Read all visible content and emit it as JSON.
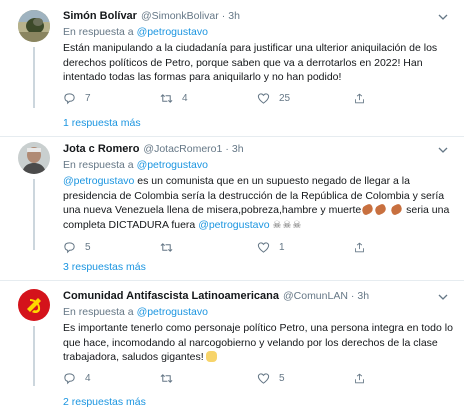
{
  "tweets": [
    {
      "name": "Simón Bolívar",
      "handle": "@SimonkBolivar",
      "dot": "·",
      "time": "3h",
      "reply_prefix": "En respuesta a",
      "reply_mention": "@petrogustavo",
      "text": "Están manipulando a la ciudadanía para justificar una ulterior aniquilación de los derechos políticos de Petro, porque saben que va a derrotarlos en 2022! Han intentado todas las formas para aniquilarlo y no han podido!",
      "replies": "7",
      "retweets": "4",
      "likes": "25",
      "more_replies": "1 respuesta más"
    },
    {
      "name": "Jota c Romero",
      "handle": "@JotacRomero1",
      "dot": "·",
      "time": "3h",
      "reply_prefix": "En respuesta a",
      "reply_mention": "@petrogustavo",
      "text_mention_start": "@petrogustavo",
      "text_part1": " es un comunista que en un supuesto negado de llegar a la presidencia de Colombia sería la destrucción de la República de Colombia y sería una nueva Venezuela llena de misera,pobreza,hambre y muerte",
      "text_part2": " seria una completa DICTADURA fuera ",
      "text_mention_end": "@petrogustavo",
      "emoji_skulls": "☠☠☠",
      "replies": "5",
      "retweets": "",
      "likes": "1",
      "more_replies": "3 respuestas más"
    },
    {
      "name": "Comunidad Antifascista Latinoamericana",
      "handle": "@ComunLAN",
      "dot": "·",
      "time": "3h",
      "reply_prefix": "En respuesta a",
      "reply_mention": "@petrogustavo",
      "text": "Es importante tenerlo como personaje político Petro, una persona integra en todo lo que hace, incomodando al narcogobierno y velando por los derechos de la clase trabajadora, saludos gigantes!",
      "replies": "4",
      "retweets": "",
      "likes": "5",
      "more_replies": "2 respuestas más"
    }
  ],
  "colors": {
    "link": "#1b95e0",
    "muted": "#657786",
    "text": "#14171a",
    "avatar3_bg": "#d4131b",
    "avatar3_symbol": "#ffd700"
  }
}
